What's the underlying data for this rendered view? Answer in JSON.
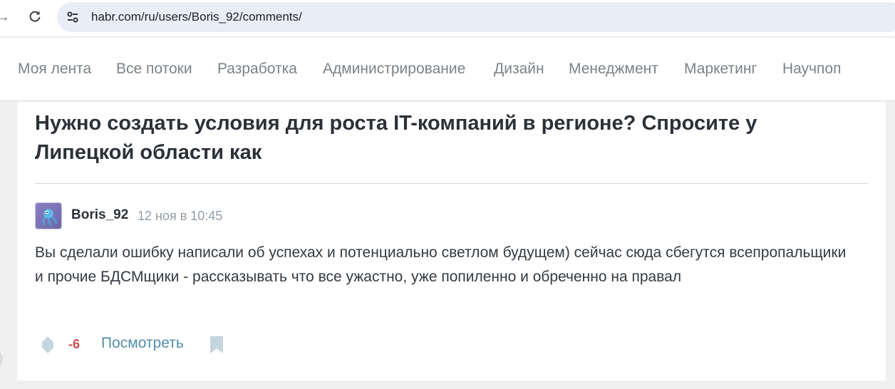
{
  "browser": {
    "url": "habr.com/ru/users/Boris_92/comments/",
    "forward_icon": "arrow-right-icon",
    "reload_icon": "reload-icon",
    "site_info_icon": "tune-icon"
  },
  "topnav": {
    "items": [
      {
        "label": "Моя лента"
      },
      {
        "label": "Все потоки"
      },
      {
        "label": "Разработка"
      },
      {
        "label": "Администрирование"
      },
      {
        "label": "Дизайн"
      },
      {
        "label": "Менеджмент"
      },
      {
        "label": "Маркетинг"
      },
      {
        "label": "Научпоп"
      }
    ]
  },
  "article": {
    "title": "Нужно создать условия для роста IT-компаний в регионе? Спросите у Липецкой области как"
  },
  "comment": {
    "author": "Boris_92",
    "time": "12 ноя в 10:45",
    "text": "Вы сделали ошибку написали об успехах и потенциально светлом будущем) сейчас сюда сбегутся всепропальщики и прочие БДСМщики - рассказывать что все ужастно, уже попиленно и обреченно на правал",
    "rating": "-6",
    "view_label": "Посмотреть"
  },
  "colors": {
    "rating_negative": "#d04e4e",
    "link": "#548eaa",
    "nav_text": "#7c8286",
    "title_text": "#2c3137"
  }
}
